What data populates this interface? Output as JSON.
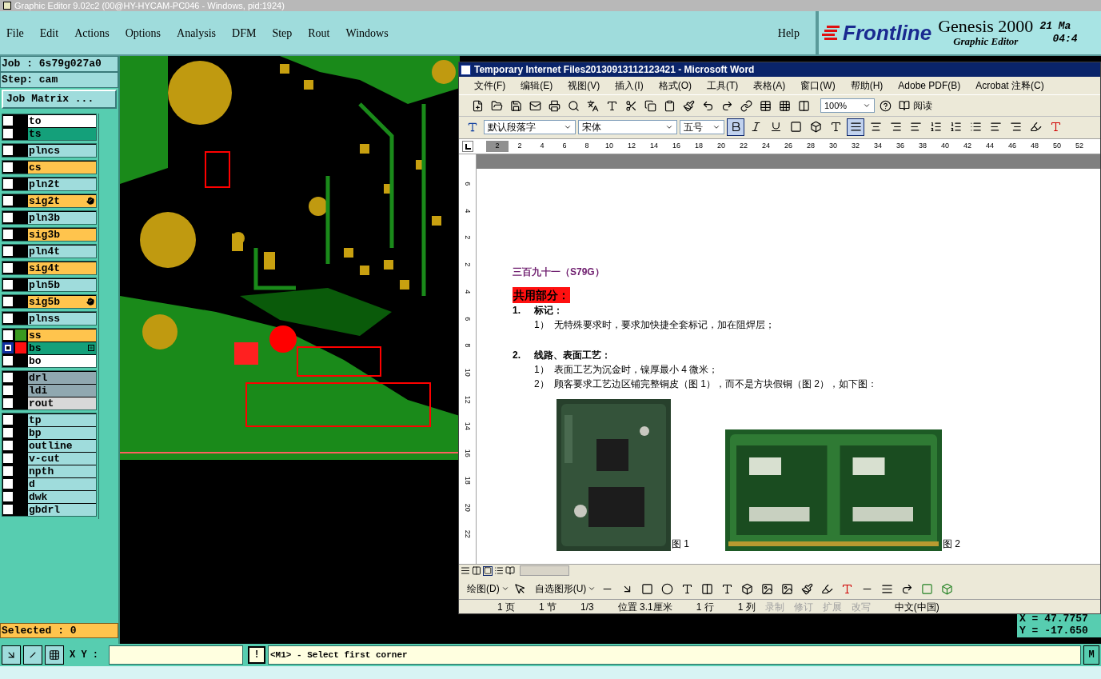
{
  "window": {
    "title": "Graphic Editor 9.02c2 (00@HY-HYCAM-PC046 - Windows, pid:1924)"
  },
  "menu": [
    {
      "label": "File"
    },
    {
      "label": "Edit"
    },
    {
      "label": "Actions"
    },
    {
      "label": "Options"
    },
    {
      "label": "Analysis"
    },
    {
      "label": "DFM"
    },
    {
      "label": "Step"
    },
    {
      "label": "Rout"
    },
    {
      "label": "Windows"
    }
  ],
  "help": "Help",
  "brand": {
    "logo": "Frontline",
    "product": "Genesis 2000",
    "subtitle": "Graphic Editor",
    "date": "21 Ma",
    "time": "04:4"
  },
  "job": {
    "job": "Job : 6s79g027a0",
    "step": "Step: cam",
    "matrix_button": "Job Matrix ..."
  },
  "layer_groups": [
    {
      "layers": [
        {
          "name": "to",
          "kind": "silk",
          "selected": false
        },
        {
          "name": "ts",
          "kind": "mask",
          "selected": false
        }
      ]
    },
    {
      "layers": [
        {
          "name": "plncs",
          "kind": "plane",
          "selected": false
        }
      ]
    },
    {
      "layers": [
        {
          "name": "cs",
          "kind": "signal",
          "selected": false
        }
      ]
    },
    {
      "layers": [
        {
          "name": "pln2t",
          "kind": "plane",
          "selected": false
        }
      ]
    },
    {
      "layers": [
        {
          "name": "sig2t",
          "kind": "signal",
          "selected": false,
          "edited": true
        }
      ]
    },
    {
      "layers": [
        {
          "name": "pln3b",
          "kind": "plane",
          "selected": false
        }
      ]
    },
    {
      "layers": [
        {
          "name": "sig3b",
          "kind": "signal",
          "selected": false
        }
      ]
    },
    {
      "layers": [
        {
          "name": "pln4t",
          "kind": "plane",
          "selected": false
        }
      ]
    },
    {
      "layers": [
        {
          "name": "sig4t",
          "kind": "signal",
          "selected": false
        }
      ]
    },
    {
      "layers": [
        {
          "name": "pln5b",
          "kind": "plane",
          "selected": false
        }
      ]
    },
    {
      "layers": [
        {
          "name": "sig5b",
          "kind": "signal",
          "selected": false,
          "edited": true
        }
      ]
    },
    {
      "layers": [
        {
          "name": "plnss",
          "kind": "plane",
          "selected": false
        }
      ]
    },
    {
      "layers": [
        {
          "name": "ss",
          "kind": "signal",
          "selected": false,
          "color": "#3a9a20"
        },
        {
          "name": "bs",
          "kind": "mask",
          "selected": true,
          "color": "#ff1010",
          "expanded": true
        },
        {
          "name": "bo",
          "kind": "silk",
          "selected": false
        }
      ]
    },
    {
      "layers": [
        {
          "name": "drl",
          "kind": "drill",
          "selected": false
        },
        {
          "name": "ldi",
          "kind": "drill",
          "selected": false
        },
        {
          "name": "rout",
          "kind": "rout",
          "selected": false
        }
      ]
    },
    {
      "layers": [
        {
          "name": "tp",
          "kind": "document",
          "selected": false
        },
        {
          "name": "bp",
          "kind": "document",
          "selected": false
        },
        {
          "name": "outline",
          "kind": "document",
          "selected": false
        },
        {
          "name": "v-cut",
          "kind": "document",
          "selected": false
        },
        {
          "name": "npth",
          "kind": "document",
          "selected": false
        },
        {
          "name": "d",
          "kind": "document",
          "selected": false
        },
        {
          "name": "dwk",
          "kind": "document",
          "selected": false
        },
        {
          "name": "gbdrl",
          "kind": "document",
          "selected": false
        }
      ]
    }
  ],
  "selected_count": "Selected : 0",
  "coordinates": {
    "x": "X = 47.7757",
    "y": "Y = -17.650"
  },
  "command_bar": {
    "xy_label": "X Y :",
    "alert_button": "!",
    "message": "<M1> - Select first corner",
    "right_button": "M"
  },
  "word": {
    "title": "Temporary Internet Files20130913112123421 - Microsoft Word",
    "menu": [
      {
        "label": "文件(F)"
      },
      {
        "label": "编辑(E)"
      },
      {
        "label": "视图(V)"
      },
      {
        "label": "插入(I)"
      },
      {
        "label": "格式(O)"
      },
      {
        "label": "工具(T)"
      },
      {
        "label": "表格(A)"
      },
      {
        "label": "窗口(W)"
      },
      {
        "label": "帮助(H)"
      },
      {
        "label": "Adobe PDF(B)"
      },
      {
        "label": "Acrobat 注释(C)"
      }
    ],
    "zoom": "100%",
    "read_button": "阅读",
    "style": "默认段落字",
    "font": "宋体",
    "size": "五号",
    "ruler": [
      "2",
      "2",
      "4",
      "6",
      "8",
      "10",
      "12",
      "14",
      "16",
      "18",
      "20",
      "22",
      "24",
      "26",
      "28",
      "30",
      "32",
      "34",
      "36",
      "38",
      "40",
      "42",
      "44",
      "46",
      "48",
      "50",
      "52"
    ],
    "vertical_ruler": [
      "6",
      "4",
      "2",
      "2",
      "4",
      "6",
      "8",
      "10",
      "12",
      "14",
      "16",
      "18",
      "20",
      "22"
    ],
    "document": {
      "heading": "三百九十一（S79G）",
      "highlight": "共用部分：",
      "sections": [
        {
          "number": "1.",
          "title": "标记：",
          "items": [
            {
              "number": "1）",
              "text": "无特殊要求时，要求加快捷全套标记，加在阻焊层；"
            }
          ]
        },
        {
          "number": "2.",
          "title": "线路、表面工艺：",
          "items": [
            {
              "number": "1）",
              "text": "表面工艺为沉金时，镍厚最小 4 微米；"
            },
            {
              "number": "2）",
              "text": "顾客要求工艺边区铺完整铜皮（图 1），而不是方块假铜（图 2），如下图："
            }
          ]
        }
      ],
      "figures": [
        {
          "caption": "图 1"
        },
        {
          "caption": "图 2"
        }
      ]
    },
    "draw_toolbar": {
      "draw": "绘图(D)",
      "autoshapes": "自选图形(U)"
    },
    "status": [
      {
        "text": "1 页",
        "disabled": false
      },
      {
        "text": "1 节",
        "disabled": false
      },
      {
        "text": "1/3",
        "disabled": false
      },
      {
        "text": "位置 3.1厘米",
        "disabled": false
      },
      {
        "text": "1 行",
        "disabled": false
      },
      {
        "text": "1 列",
        "disabled": false
      },
      {
        "text": "录制",
        "disabled": true
      },
      {
        "text": "修订",
        "disabled": true
      },
      {
        "text": "扩展",
        "disabled": true
      },
      {
        "text": "改写",
        "disabled": true
      },
      {
        "text": "中文(中国)",
        "disabled": false
      }
    ]
  }
}
